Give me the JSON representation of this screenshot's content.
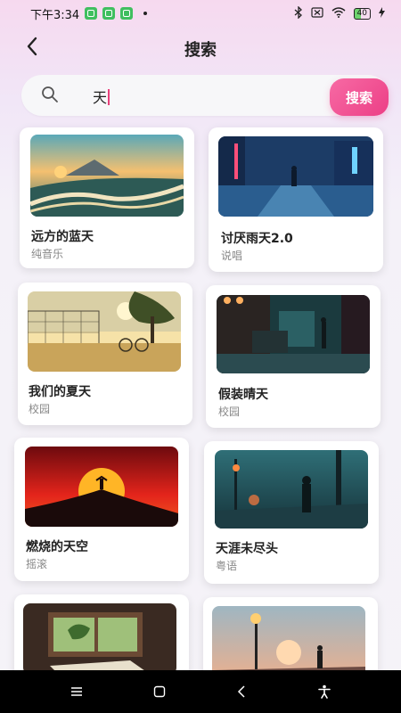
{
  "status_bar": {
    "time": "下午3:34",
    "battery_level": "40"
  },
  "header": {
    "title": "搜索",
    "back_icon": "chevron-left-icon"
  },
  "search": {
    "value": "天",
    "button_label": "搜索",
    "icon": "search-icon"
  },
  "results": [
    {
      "title": "远方的蓝天",
      "category": "纯音乐"
    },
    {
      "title": "讨厌雨天2.0",
      "category": "说唱"
    },
    {
      "title": "我们的夏天",
      "category": "校园"
    },
    {
      "title": "假装晴天",
      "category": "校园"
    },
    {
      "title": "燃烧的天空",
      "category": "摇滚"
    },
    {
      "title": "天涯未尽头",
      "category": "粤语"
    },
    {
      "title": "",
      "category": ""
    },
    {
      "title": "",
      "category": ""
    }
  ],
  "nav_bar": {
    "items": [
      "menu-icon",
      "home-square-icon",
      "back-triangle-icon",
      "accessibility-icon"
    ]
  },
  "colors": {
    "accent": "#ec3f86",
    "background": "#f5f3f8",
    "card": "#ffffff"
  }
}
